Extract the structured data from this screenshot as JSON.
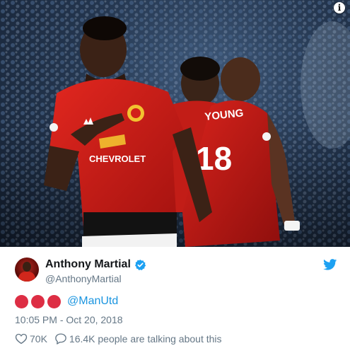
{
  "media": {
    "icon": "info-icon",
    "info_label": "i",
    "jersey_sponsor": "CHEVROLET",
    "jersey_name": "YOUNG",
    "jersey_number": "18"
  },
  "tweet": {
    "author_name": "Anthony Martial",
    "author_handle": "@AnthonyMartial",
    "verified": true,
    "emoji_count": 3,
    "emoji_color": "#dd2e44",
    "mention": "@ManUtd",
    "timestamp": "10:05 PM - Oct 20, 2018",
    "likes": "70K",
    "talking": "16.4K people are talking about this"
  },
  "colors": {
    "twitter_blue": "#1da1f2",
    "link": "#1b95e0",
    "muted": "#657786",
    "united_red": "#da291c"
  }
}
